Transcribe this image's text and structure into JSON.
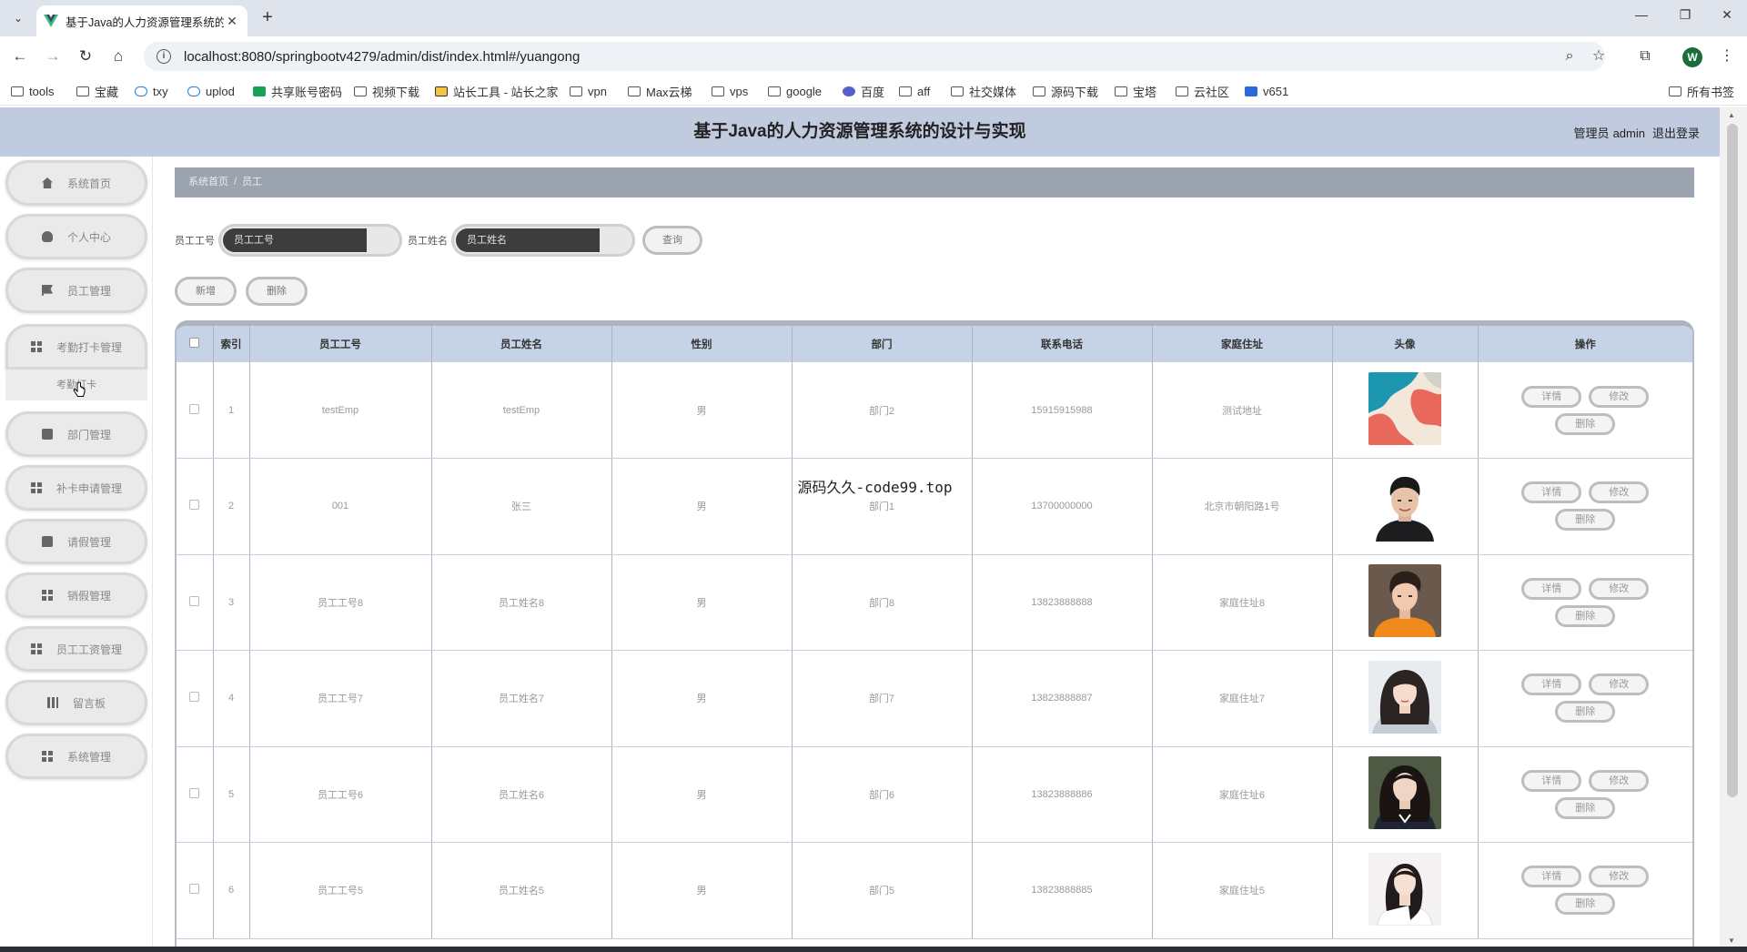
{
  "browser": {
    "tab_title": "基于Java的人力资源管理系统的",
    "url": "localhost:8080/springbootv4279/admin/dist/index.html#/yuangong",
    "bookmarks": [
      {
        "label": "tools",
        "icon": "folder-icon"
      },
      {
        "label": "宝藏",
        "icon": "folder-icon"
      },
      {
        "label": "txy",
        "icon": "cloud-icon"
      },
      {
        "label": "uplod",
        "icon": "cloud-icon"
      },
      {
        "label": "共享账号密码",
        "icon": "sheet-icon"
      },
      {
        "label": "视频下载",
        "icon": "folder-icon"
      },
      {
        "label": "站长工具 - 站长之家",
        "icon": "site-icon"
      },
      {
        "label": "vpn",
        "icon": "folder-icon"
      },
      {
        "label": "Max云梯",
        "icon": "folder-icon"
      },
      {
        "label": "vps",
        "icon": "folder-icon"
      },
      {
        "label": "google",
        "icon": "folder-icon"
      },
      {
        "label": "百度",
        "icon": "baidu-icon"
      },
      {
        "label": "aff",
        "icon": "folder-icon"
      },
      {
        "label": "社交媒体",
        "icon": "folder-icon"
      },
      {
        "label": "源码下载",
        "icon": "folder-icon"
      },
      {
        "label": "宝塔",
        "icon": "folder-icon"
      },
      {
        "label": "云社区",
        "icon": "folder-icon"
      },
      {
        "label": "v651",
        "icon": "app-icon"
      }
    ],
    "all_bookmarks": "所有书签",
    "profile_initial": "W"
  },
  "header": {
    "title": "基于Java的人力资源管理系统的设计与实现",
    "role": "管理员",
    "username": "admin",
    "logout": "退出登录",
    "bg_color": "#c1cbe0"
  },
  "sidebar": {
    "items": [
      {
        "label": "系统首页",
        "icon": "home-icon"
      },
      {
        "label": "个人中心",
        "icon": "user-icon"
      },
      {
        "label": "员工管理",
        "icon": "flag-icon"
      },
      {
        "label": "考勤打卡管理",
        "icon": "grid-icon"
      },
      {
        "label": "部门管理",
        "icon": "doc-icon"
      },
      {
        "label": "补卡申请管理",
        "icon": "grid-icon"
      },
      {
        "label": "请假管理",
        "icon": "chat-icon"
      },
      {
        "label": "销假管理",
        "icon": "grid-icon"
      },
      {
        "label": "员工工资管理",
        "icon": "grid-icon"
      },
      {
        "label": "留言板",
        "icon": "bars-icon"
      },
      {
        "label": "系统管理",
        "icon": "grid-icon"
      }
    ],
    "submenu_label": "考勤打卡"
  },
  "breadcrumb": {
    "home": "系统首页",
    "separator": "/",
    "current": "员工"
  },
  "search": {
    "emp_no_label": "员工工号",
    "emp_no_placeholder": "员工工号",
    "emp_name_label": "员工姓名",
    "emp_name_placeholder": "员工姓名",
    "query_button": "查询"
  },
  "actions": {
    "add": "新增",
    "delete": "删除"
  },
  "table": {
    "columns": [
      "索引",
      "员工工号",
      "员工姓名",
      "性别",
      "部门",
      "联系电话",
      "家庭住址",
      "头像",
      "操作"
    ],
    "rows": [
      {
        "index": "1",
        "emp_no": "testEmp",
        "emp_name": "testEmp",
        "gender": "男",
        "dept": "部门2",
        "phone": "15915915988",
        "address": "测试地址",
        "avatar": "abstract-avatar"
      },
      {
        "index": "2",
        "emp_no": "001",
        "emp_name": "张三",
        "gender": "男",
        "dept": "部门1",
        "phone": "13700000000",
        "address": "北京市朝阳路1号",
        "avatar": "man-portrait"
      },
      {
        "index": "3",
        "emp_no": "员工工号8",
        "emp_name": "员工姓名8",
        "gender": "男",
        "dept": "部门8",
        "phone": "13823888888",
        "address": "家庭住址8",
        "avatar": "man-orange-portrait"
      },
      {
        "index": "4",
        "emp_no": "员工工号7",
        "emp_name": "员工姓名7",
        "gender": "男",
        "dept": "部门7",
        "phone": "13823888887",
        "address": "家庭住址7",
        "avatar": "woman-portrait"
      },
      {
        "index": "5",
        "emp_no": "员工工号6",
        "emp_name": "员工姓名6",
        "gender": "男",
        "dept": "部门6",
        "phone": "13823888886",
        "address": "家庭住址6",
        "avatar": "woman-dark-portrait"
      },
      {
        "index": "6",
        "emp_no": "员工工号5",
        "emp_name": "员工姓名5",
        "gender": "男",
        "dept": "部门5",
        "phone": "13823888885",
        "address": "家庭住址5",
        "avatar": "woman-white-portrait"
      }
    ],
    "op_detail": "详情",
    "op_edit": "修改",
    "op_delete": "删除"
  },
  "watermark": "源码久久-code99.top"
}
